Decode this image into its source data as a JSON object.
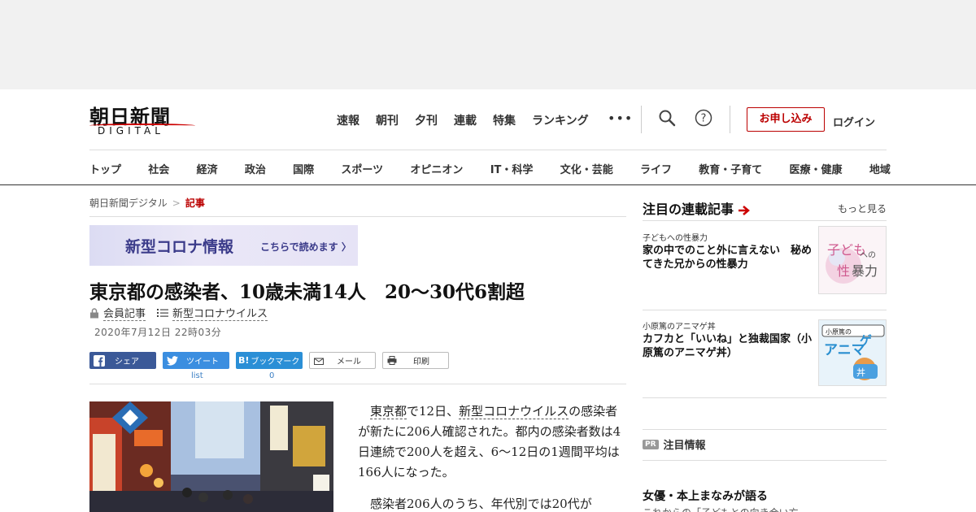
{
  "header": {
    "logo_main": "朝日新聞",
    "logo_sub": "DIGITAL",
    "topnav": [
      "速報",
      "朝刊",
      "夕刊",
      "連載",
      "特集",
      "ランキング"
    ],
    "more": "•••",
    "apply_label": "お申し込み",
    "login_label": "ログイン",
    "categories": [
      "トップ",
      "社会",
      "経済",
      "政治",
      "国際",
      "スポーツ",
      "オピニオン",
      "IT・科学",
      "文化・芸能",
      "ライフ",
      "教育・子育て",
      "医療・健康",
      "地域"
    ]
  },
  "breadcrumb": {
    "home": "朝日新聞デジタル",
    "separator": ">",
    "current": "記事"
  },
  "banner": {
    "title": "新型コロナ情報",
    "cta": "こちらで読めます"
  },
  "article": {
    "headline": "東京都の感染者、10歳未満14人　20～30代6割超",
    "member_label": "会員記事",
    "topic_label": "新型コロナウイルス",
    "date": "2020年7月12日 22時03分",
    "share": {
      "facebook": "シェア",
      "twitter": "ツイート",
      "twitter_count": "list",
      "hatena": "ブックマーク",
      "hatena_count": "0",
      "mail": "メール",
      "print": "印刷"
    },
    "body": {
      "p1_link1": "東京都",
      "p1_text1": "で12日、",
      "p1_link2": "新型コロナウイルス",
      "p1_text2": "の感染者が新たに206人確認された。都内の感染者数は4日連続で200人を超え、6～12日の1週間平均は166人になった。",
      "p2": "感染者206人のうち、年代別では20代が"
    }
  },
  "sidebar": {
    "title": "注目の連載記事",
    "more": "もっと見る",
    "items": [
      {
        "category": "子どもへの性暴力",
        "title": "家の中でのこと外に言えない　秘めてきた兄からの性暴力",
        "thumb_text": "子どもへの性暴力"
      },
      {
        "category": "小原篤のアニマゲ丼",
        "title": "カフカと「いいね」と独裁国家（小原篤のアニマゲ丼）",
        "thumb_text": "小原篤のアニマゲ丼"
      }
    ],
    "pr_badge": "PR",
    "pr_label": "注目情報",
    "bottom_title": "女優・本上まなみが語る",
    "bottom_text": "これからの「子どもとの向き合い方"
  },
  "colors": {
    "accent": "#bb0000",
    "facebook": "#3b5998",
    "twitter": "#1da1f2",
    "hatena": "#00a4de"
  }
}
